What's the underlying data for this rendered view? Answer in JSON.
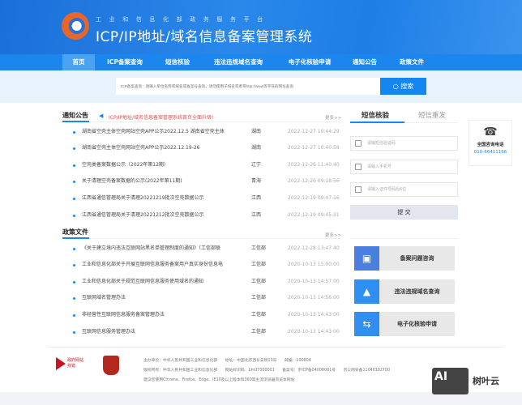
{
  "header": {
    "subtitle": "工业和信息化部政务服务平台",
    "title": "ICP/IP地址/域名信息备案管理系统"
  },
  "nav": [
    "首页",
    "ICP备案查询",
    "短信核验",
    "违法违规域名查询",
    "电子化核验申请",
    "通知公告",
    "政策文件"
  ],
  "search": {
    "placeholder": "ICP备案查询：请输入单位名称或域名或备案号查询，请勿使用子域名或者带http://www等字符的网址查询",
    "button": "搜索"
  },
  "notices": {
    "title": "通知公告",
    "marquee": "ICP/IP地址/域名信息备案管理系统首页全面升级!",
    "more": "更多>>",
    "items": [
      {
        "title": "湖南省空壳主体空壳网站空壳APP公示2022.12.5 湖南省空壳主体",
        "region": "湖南",
        "date": "2022-12-27 10:44:29"
      },
      {
        "title": "湖南省空壳主体空壳网站空壳APP公示2022.12.19-26",
        "region": "湖南",
        "date": "2022-12-27 10:40:58"
      },
      {
        "title": "空壳类备案数据公示（2022年第12期）",
        "region": "辽宁",
        "date": "2022-12-26 11:40:40"
      },
      {
        "title": "关于清理空壳备案数据的公示(2022年第11期)",
        "region": "青海",
        "date": "2022-12-26 09:18:56"
      },
      {
        "title": "江西省通信管理局关于清理20221219批次空壳数据公示",
        "region": "江西",
        "date": "2022-12-19 09:47:16"
      },
      {
        "title": "江西省通信管理局关于清理20221212批次空壳数据公示",
        "region": "江西",
        "date": "2022-12-19 09:45:31"
      }
    ]
  },
  "policies": {
    "title": "政策文件",
    "more": "更多>>",
    "items": [
      {
        "title": "《关于建立境内违法互联网站黑名单管理制度的通知》（工信部联",
        "region": "工信部",
        "date": "2022-12-28 13:47:40"
      },
      {
        "title": "工业和信息化部关于开展互联网信息服务备案用户真实身份信息电",
        "region": "工信部",
        "date": "2020-10-13 15:00:00"
      },
      {
        "title": "工业和信息化部关于规范互联网信息服务使用域名的通知",
        "region": "工信部",
        "date": "2020-10-13 14:57:00"
      },
      {
        "title": "互联网域名管理办法",
        "region": "工信部",
        "date": "2020-10-13 14:56:00"
      },
      {
        "title": "非经营性互联网信息服务备案管理办法",
        "region": "工信部",
        "date": "2020-10-13 14:43:00"
      },
      {
        "title": "互联网信息服务管理办法",
        "region": "工信部",
        "date": "2020-10-13 14:43:00"
      }
    ]
  },
  "sms": {
    "tabs": [
      "短信核验",
      "短信重发"
    ],
    "fields": [
      "请输短信验证码",
      "请输入手机号",
      "请输入证件号码后6位"
    ],
    "submit": "提 交"
  },
  "quick": [
    {
      "label": "备案问题咨询",
      "icon": "consult-icon",
      "color": "#4a7fe0"
    },
    {
      "label": "违法违规域名查询",
      "icon": "warning-icon",
      "color": "#2f8ff0"
    },
    {
      "label": "电子化核验申请",
      "icon": "exchange-icon",
      "color": "#2f8ff0"
    }
  ],
  "phone": {
    "label": "全国咨询电话",
    "number": "010-66411166"
  },
  "footer": {
    "gov_badge": "政府网站 找错",
    "line1": "主办单位：中华人民共和国工业和信息化部　　地址：中国北京西长安街13号　　邮编：100804",
    "line2": "版权所有：中华人民共和国工业和信息化部　　网站标识码：bm07000001　　备案号：京ICP备04000001号　　京公网安备11040102700",
    "line3": "建议您使用Chrome、Firefox、Edge、IE10及以上版本和360等主流浏览器浏览本网站"
  },
  "watermark": "树叶云"
}
